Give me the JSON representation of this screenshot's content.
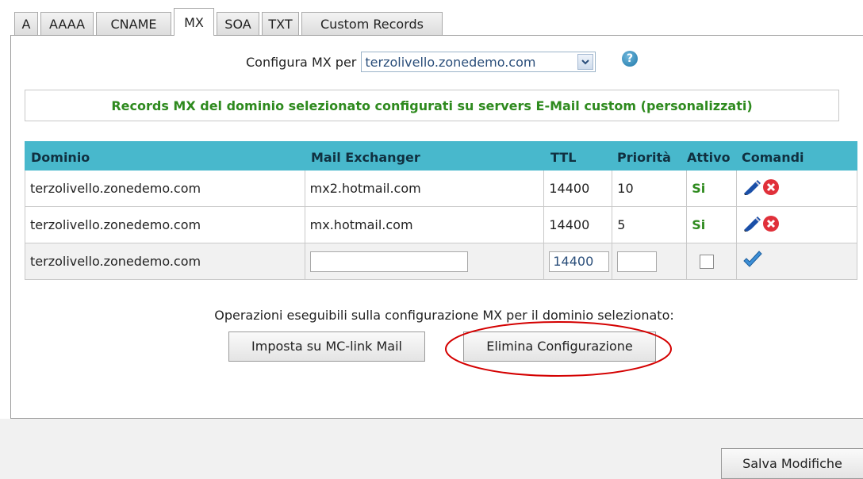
{
  "tabs": [
    {
      "label": "A"
    },
    {
      "label": "AAAA"
    },
    {
      "label": "CNAME"
    },
    {
      "label": "MX",
      "active": true
    },
    {
      "label": "SOA"
    },
    {
      "label": "TXT"
    },
    {
      "label": "Custom Records"
    }
  ],
  "config": {
    "label": "Configura MX per",
    "selected_domain": "terzolivello.zonedemo.com"
  },
  "info_message": "Records MX del dominio selezionato configurati su servers E-Mail custom (personalizzati)",
  "table": {
    "headers": {
      "domain": "Dominio",
      "exchanger": "Mail Exchanger",
      "ttl": "TTL",
      "priority": "Priorità",
      "active": "Attivo",
      "commands": "Comandi"
    },
    "rows": [
      {
        "domain": "terzolivello.zonedemo.com",
        "exchanger": "mx2.hotmail.com",
        "ttl": "14400",
        "priority": "10",
        "active": "Si"
      },
      {
        "domain": "terzolivello.zonedemo.com",
        "exchanger": "mx.hotmail.com",
        "ttl": "14400",
        "priority": "5",
        "active": "Si"
      }
    ],
    "new_row": {
      "domain": "terzolivello.zonedemo.com",
      "exchanger_value": "",
      "ttl_value": "14400",
      "priority_value": "",
      "active_checked": false
    }
  },
  "operations": {
    "text": "Operazioni eseguibili sulla configurazione MX per il dominio selezionato:",
    "set_mclink_label": "Imposta su MC-link Mail",
    "delete_config_label": "Elimina Configurazione"
  },
  "footer": {
    "save_label": "Salva Modifiche"
  },
  "colors": {
    "header_bg": "#48b8cc",
    "info_text": "#2e8a1e",
    "highlight": "#d40000"
  }
}
